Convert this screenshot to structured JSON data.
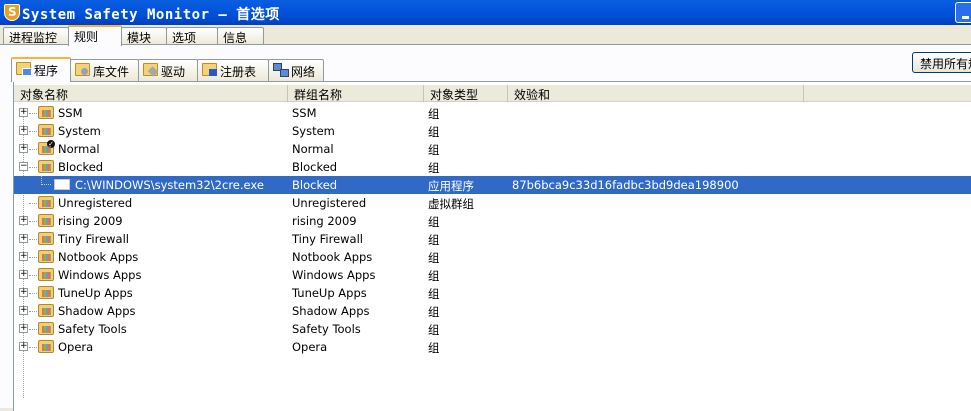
{
  "window": {
    "title": "System Safety Monitor — 首选项"
  },
  "main_tabs": [
    {
      "label": "进程监控器"
    },
    {
      "label": "规则",
      "active": true
    },
    {
      "label": "模块"
    },
    {
      "label": "选项"
    },
    {
      "label": "信息"
    }
  ],
  "sub_tabs": [
    {
      "label": "程序",
      "icon": "program-icon",
      "active": true
    },
    {
      "label": "库文件",
      "icon": "library-icon"
    },
    {
      "label": "驱动",
      "icon": "driver-icon"
    },
    {
      "label": "注册表",
      "icon": "registry-icon"
    },
    {
      "label": "网络",
      "icon": "network-icon"
    }
  ],
  "disable_button": "禁用所有规",
  "columns": [
    "对象名称",
    "群组名称",
    "对象类型",
    "效验和"
  ],
  "rows": [
    {
      "name": "SSM",
      "group": "SSM",
      "type": "组",
      "checksum": "",
      "state": "collapsed"
    },
    {
      "name": "System",
      "group": "System",
      "type": "组",
      "checksum": "",
      "state": "collapsed"
    },
    {
      "name": "Normal",
      "group": "Normal",
      "type": "组",
      "checksum": "",
      "state": "collapsed",
      "badge": "check"
    },
    {
      "name": "Blocked",
      "group": "Blocked",
      "type": "组",
      "checksum": "",
      "state": "expanded"
    },
    {
      "name": "C:\\WINDOWS\\system32\\2cre.exe",
      "group": "Blocked",
      "type": "应用程序",
      "checksum": "87b6bca9c33d16fadbc3bd9dea198900",
      "state": "child",
      "selected": true
    },
    {
      "name": "Unregistered",
      "group": "Unregistered",
      "type": "虚拟群组",
      "checksum": "",
      "state": "leaf"
    },
    {
      "name": "rising 2009",
      "group": "rising 2009",
      "type": "组",
      "checksum": "",
      "state": "collapsed"
    },
    {
      "name": "Tiny Firewall",
      "group": "Tiny Firewall",
      "type": "组",
      "checksum": "",
      "state": "collapsed"
    },
    {
      "name": "Notbook Apps",
      "group": "Notbook Apps",
      "type": "组",
      "checksum": "",
      "state": "collapsed"
    },
    {
      "name": "Windows Apps",
      "group": "Windows Apps",
      "type": "组",
      "checksum": "",
      "state": "collapsed"
    },
    {
      "name": "TuneUp Apps",
      "group": "TuneUp Apps",
      "type": "组",
      "checksum": "",
      "state": "collapsed"
    },
    {
      "name": "Shadow Apps",
      "group": "Shadow Apps",
      "type": "组",
      "checksum": "",
      "state": "collapsed"
    },
    {
      "name": "Safety Tools",
      "group": "Safety Tools",
      "type": "组",
      "checksum": "",
      "state": "collapsed"
    },
    {
      "name": "Opera",
      "group": "Opera",
      "type": "组",
      "checksum": "",
      "state": "collapsed"
    }
  ],
  "colors": {
    "titlebar": "#0050d8",
    "selection": "#316ac5",
    "tab_highlight": "#f9b33a"
  }
}
